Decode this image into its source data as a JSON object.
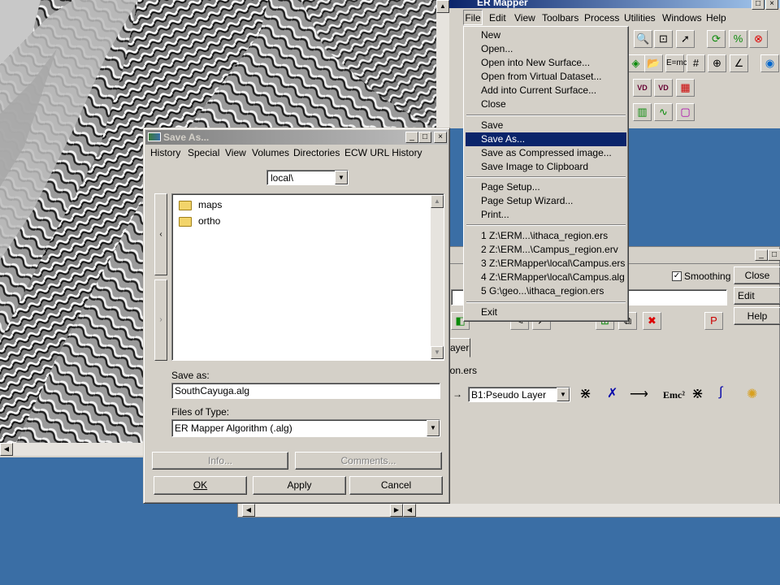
{
  "main_window": {
    "title": "ER Mapper",
    "menu": [
      "File",
      "Edit",
      "View",
      "Toolbars",
      "Process",
      "Utilities",
      "Windows",
      "Help"
    ]
  },
  "file_menu": {
    "items": [
      "New",
      "Open...",
      "Open into New Surface...",
      "Open from Virtual Dataset...",
      "Add into Current Surface...",
      "Close",
      "Save",
      "Save As...",
      "Save as Compressed image...",
      "Save Image to Clipboard",
      "Page Setup...",
      "Page Setup Wizard...",
      "Print...",
      "1 Z:\\ERM...\\ithaca_region.ers",
      "2 Z:\\ERM...\\Campus_region.erv",
      "3 Z:\\ERMapper\\local\\Campus.ers",
      "4 Z:\\ERMapper\\local\\Campus.alg",
      "5 G:\\geo...\\ithaca_region.ers",
      "Exit"
    ],
    "highlighted": "Save As..."
  },
  "algorithm_window": {
    "smoothing_label": "Smoothing",
    "smoothing_checked": true,
    "close_label": "Close",
    "edit_label": "Edit",
    "help_label": "Help",
    "tab_fragment": "ayer",
    "file_fragment": "ion.ers",
    "layer_select": "B1:Pseudo Layer",
    "emc": "Emc²"
  },
  "save_dialog": {
    "title": "Save As...",
    "menu": [
      "History",
      "Special",
      "View",
      "Volumes",
      "Directories",
      "ECW URL History"
    ],
    "location": "local\\",
    "folders": [
      "maps",
      "ortho"
    ],
    "save_as_label": "Save as:",
    "save_as_value": "SouthCayuga.alg",
    "type_label": "Files of Type:",
    "type_value": "ER Mapper Algorithm (.alg)",
    "info_label": "Info...",
    "comments_label": "Comments...",
    "ok_label": "OK",
    "apply_label": "Apply",
    "cancel_label": "Cancel"
  },
  "colors": {
    "desktop": "#3a6ea5",
    "highlight": "#0a246a",
    "face": "#d4d0c8"
  }
}
